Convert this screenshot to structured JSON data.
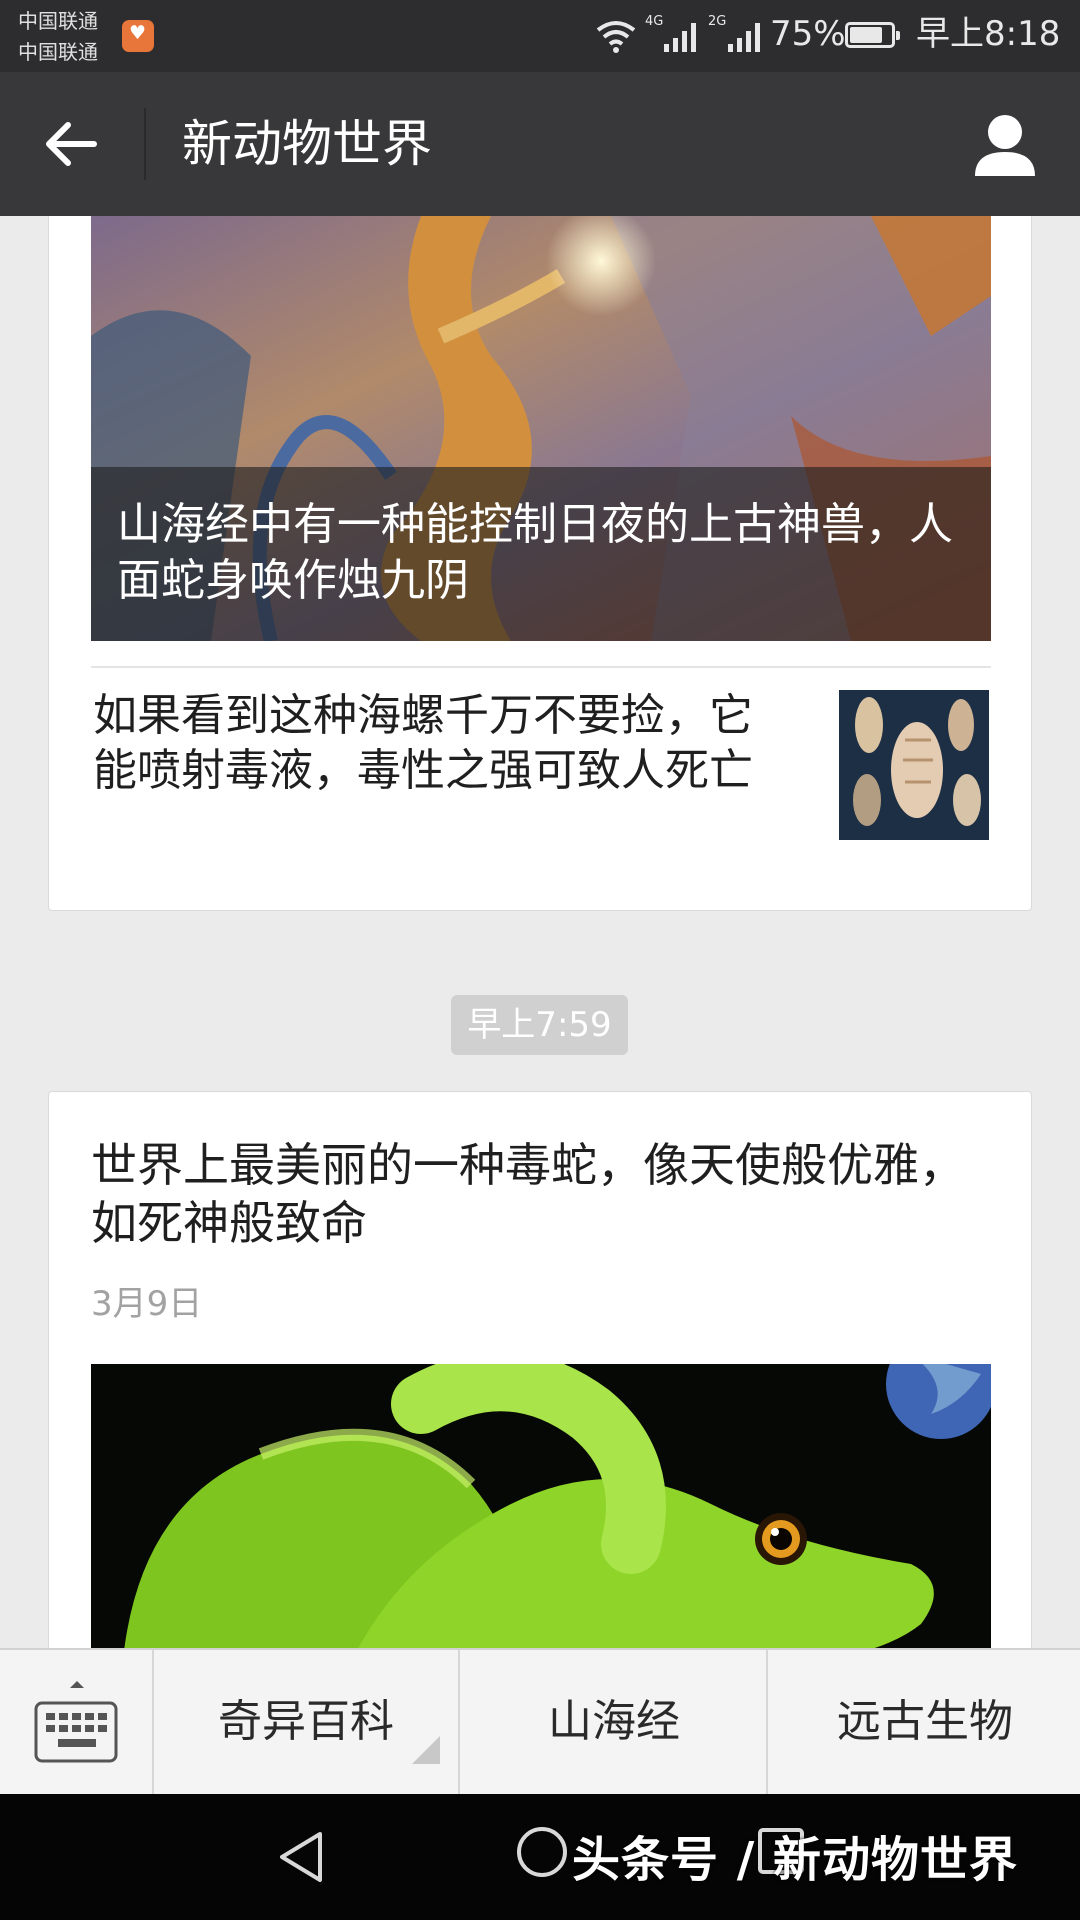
{
  "status_bar": {
    "carrier_1": "中国联通",
    "carrier_2": "中国联通",
    "network_1": "4G",
    "network_2": "2G",
    "battery": "75%",
    "time": "早上8:18"
  },
  "nav": {
    "title": "新动物世界",
    "back_icon": "arrow-left-icon",
    "profile_icon": "person-icon"
  },
  "feed": {
    "card_1": {
      "hero_caption": "山海经中有一种能控制日夜的上古神兽，人面蛇身唤作烛九阴",
      "item_title": "如果看到这种海螺千万不要捡，它能喷射毒液，毒性之强可致人死亡"
    },
    "timestamp": "早上7:59",
    "card_2": {
      "title": "世界上最美丽的一种毒蛇，像天使般优雅，如死神般致命",
      "date": "3月9日"
    }
  },
  "menu": {
    "keyboard_icon": "keyboard-icon",
    "items": [
      {
        "label": "奇异百科"
      },
      {
        "label": "山海经"
      },
      {
        "label": "远古生物"
      }
    ]
  },
  "watermark": "头条号 / 新动物世界",
  "colors": {
    "nav_bg": "#38383a",
    "status_bg": "#2d2d2f",
    "page_bg": "#ebebeb",
    "timestamp_bg": "#d0d0d0"
  }
}
